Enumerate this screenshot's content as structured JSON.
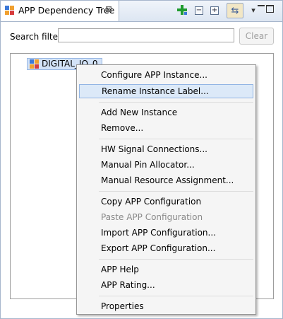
{
  "tab": {
    "title": "APP Dependency Tree",
    "close_glyph": "⊠",
    "icon": "app-dependency-icon"
  },
  "toolbar": {
    "add_icon": "add-plus-icon",
    "collapse_glyph": "−",
    "expand_glyph": "+",
    "link_glyph": "⇆",
    "menu_glyph": "▾"
  },
  "search": {
    "label": "Search filter",
    "value": "",
    "placeholder": "",
    "clear_label": "Clear"
  },
  "tree": {
    "node_label": "DIGITAL_IO_0",
    "node_icon": "app-instance-icon"
  },
  "context_menu": {
    "configure": "Configure APP Instance...",
    "rename": "Rename Instance Label...",
    "add_new": "Add New Instance",
    "remove": "Remove...",
    "hw_signal": "HW Signal Connections...",
    "manual_pin": "Manual Pin Allocator...",
    "manual_resource": "Manual Resource Assignment...",
    "copy_config": "Copy APP Configuration",
    "paste_config": "Paste APP Configuration",
    "import_config": "Import APP Configuration...",
    "export_config": "Export APP Configuration...",
    "app_help": "APP Help",
    "app_rating": "APP Rating...",
    "properties": "Properties"
  },
  "colors": {
    "accent_selected": "#dce9f8",
    "icon_blue": "#3c78d8",
    "icon_orange": "#f0a030",
    "icon_red": "#d83c3c"
  }
}
